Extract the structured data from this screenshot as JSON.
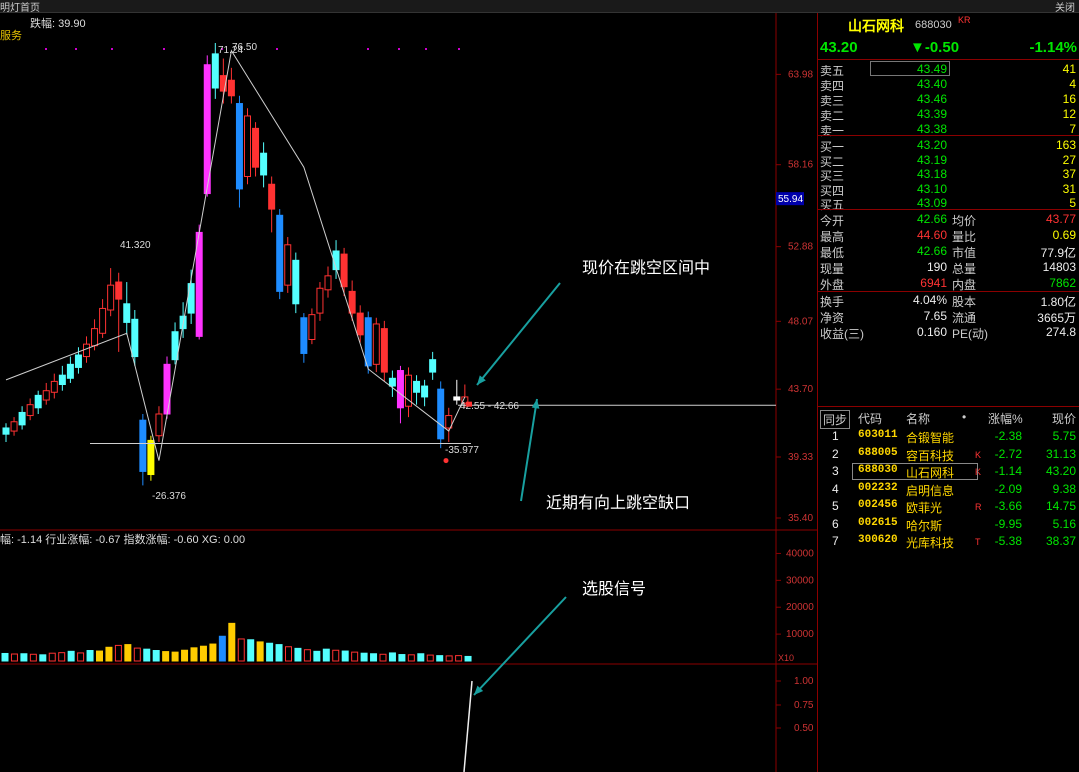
{
  "window": {
    "tab_title": "明灯首页",
    "close_label": "关闭"
  },
  "chart_header": {
    "change_range": "跌幅: 39.90",
    "service_label": "服务"
  },
  "chart_data": [
    {
      "type": "candlestick",
      "title": "",
      "y_ticks": [
        "63.98",
        "58.16",
        "52.88",
        "48.07",
        "43.70",
        "39.33",
        "35.40"
      ],
      "current_price_tag": "55.94",
      "price_annotations": [
        "41.320",
        "71.24",
        "76.50",
        "-26.376",
        "42.55 - 42.66",
        "-35.977"
      ],
      "ylim": [
        35.4,
        66.0
      ],
      "candles": [
        {
          "o": 40.8,
          "c": 41.2,
          "h": 41.5,
          "l": 40.3,
          "color": "cyan"
        },
        {
          "o": 41.0,
          "c": 41.6,
          "h": 41.9,
          "l": 40.7,
          "color": "red"
        },
        {
          "o": 41.4,
          "c": 42.2,
          "h": 42.6,
          "l": 41.1,
          "color": "cyan"
        },
        {
          "o": 42.0,
          "c": 42.7,
          "h": 43.1,
          "l": 41.7,
          "color": "red"
        },
        {
          "o": 42.5,
          "c": 43.3,
          "h": 43.6,
          "l": 42.1,
          "color": "cyan"
        },
        {
          "o": 43.0,
          "c": 43.6,
          "h": 44.1,
          "l": 42.7,
          "color": "red"
        },
        {
          "o": 43.5,
          "c": 44.2,
          "h": 44.7,
          "l": 43.1,
          "color": "red"
        },
        {
          "o": 44.0,
          "c": 44.6,
          "h": 45.2,
          "l": 43.6,
          "color": "cyan"
        },
        {
          "o": 44.4,
          "c": 45.3,
          "h": 45.8,
          "l": 44.1,
          "color": "cyan"
        },
        {
          "o": 45.1,
          "c": 45.9,
          "h": 46.4,
          "l": 44.7,
          "color": "cyan"
        },
        {
          "o": 45.8,
          "c": 46.6,
          "h": 47.1,
          "l": 45.4,
          "color": "red"
        },
        {
          "o": 46.5,
          "c": 47.6,
          "h": 48.2,
          "l": 46.2,
          "color": "red"
        },
        {
          "o": 47.3,
          "c": 48.9,
          "h": 49.5,
          "l": 47.0,
          "color": "red"
        },
        {
          "o": 48.8,
          "c": 50.4,
          "h": 51.5,
          "l": 48.4,
          "color": "red"
        },
        {
          "o": 50.6,
          "c": 49.5,
          "h": 51.2,
          "l": 46.1,
          "color": "red"
        },
        {
          "o": 49.2,
          "c": 48.0,
          "h": 50.6,
          "l": 47.2,
          "color": "cyan"
        },
        {
          "o": 48.2,
          "c": 45.8,
          "h": 48.8,
          "l": 45.2,
          "color": "cyan"
        },
        {
          "o": 41.7,
          "c": 38.4,
          "h": 42.1,
          "l": 37.5,
          "color": "blue"
        },
        {
          "o": 38.2,
          "c": 40.4,
          "h": 40.7,
          "l": 37.8,
          "color": "yellow"
        },
        {
          "o": 40.7,
          "c": 42.1,
          "h": 42.6,
          "l": 40.3,
          "color": "red"
        },
        {
          "o": 42.1,
          "c": 45.3,
          "h": 45.8,
          "l": 41.8,
          "color": "magenta"
        },
        {
          "o": 45.6,
          "c": 47.4,
          "h": 48.0,
          "l": 45.3,
          "color": "cyan"
        },
        {
          "o": 47.6,
          "c": 48.4,
          "h": 49.3,
          "l": 47.0,
          "color": "cyan"
        },
        {
          "o": 48.6,
          "c": 50.5,
          "h": 51.4,
          "l": 47.9,
          "color": "cyan"
        },
        {
          "o": 47.1,
          "c": 53.8,
          "h": 54.3,
          "l": 46.9,
          "color": "magenta"
        },
        {
          "o": 56.3,
          "c": 64.6,
          "h": 65.2,
          "l": 56.1,
          "color": "magenta"
        },
        {
          "o": 63.1,
          "c": 65.3,
          "h": 66.0,
          "l": 62.4,
          "color": "cyan"
        },
        {
          "o": 63.9,
          "c": 62.9,
          "h": 65.0,
          "l": 62.1,
          "color": "red"
        },
        {
          "o": 63.6,
          "c": 62.6,
          "h": 64.4,
          "l": 62.1,
          "color": "red"
        },
        {
          "o": 62.1,
          "c": 56.6,
          "h": 62.6,
          "l": 55.4,
          "color": "blue"
        },
        {
          "o": 57.4,
          "c": 61.3,
          "h": 61.8,
          "l": 56.9,
          "color": "red"
        },
        {
          "o": 60.5,
          "c": 58.0,
          "h": 60.9,
          "l": 57.4,
          "color": "red"
        },
        {
          "o": 58.9,
          "c": 57.5,
          "h": 59.6,
          "l": 56.7,
          "color": "cyan"
        },
        {
          "o": 56.9,
          "c": 55.3,
          "h": 57.4,
          "l": 53.8,
          "color": "red"
        },
        {
          "o": 54.9,
          "c": 50.0,
          "h": 55.3,
          "l": 49.5,
          "color": "blue"
        },
        {
          "o": 50.4,
          "c": 53.0,
          "h": 53.5,
          "l": 49.9,
          "color": "red"
        },
        {
          "o": 52.0,
          "c": 49.2,
          "h": 52.5,
          "l": 48.6,
          "color": "cyan"
        },
        {
          "o": 48.3,
          "c": 46.0,
          "h": 48.6,
          "l": 45.4,
          "color": "blue"
        },
        {
          "o": 46.9,
          "c": 48.5,
          "h": 48.9,
          "l": 46.6,
          "color": "red"
        },
        {
          "o": 48.6,
          "c": 50.2,
          "h": 50.6,
          "l": 48.1,
          "color": "red"
        },
        {
          "o": 50.1,
          "c": 51.0,
          "h": 51.6,
          "l": 49.6,
          "color": "red"
        },
        {
          "o": 51.4,
          "c": 52.6,
          "h": 53.3,
          "l": 50.8,
          "color": "cyan"
        },
        {
          "o": 52.4,
          "c": 50.3,
          "h": 52.8,
          "l": 49.7,
          "color": "red"
        },
        {
          "o": 50.0,
          "c": 48.6,
          "h": 50.7,
          "l": 48.1,
          "color": "red"
        },
        {
          "o": 48.6,
          "c": 47.2,
          "h": 49.1,
          "l": 46.7,
          "color": "red"
        },
        {
          "o": 48.3,
          "c": 45.2,
          "h": 48.7,
          "l": 44.7,
          "color": "blue"
        },
        {
          "o": 45.3,
          "c": 47.9,
          "h": 48.3,
          "l": 44.8,
          "color": "red"
        },
        {
          "o": 47.6,
          "c": 44.8,
          "h": 48.1,
          "l": 44.2,
          "color": "red"
        },
        {
          "o": 44.4,
          "c": 43.9,
          "h": 44.9,
          "l": 43.2,
          "color": "cyan"
        },
        {
          "o": 44.9,
          "c": 42.5,
          "h": 45.2,
          "l": 41.5,
          "color": "magenta"
        },
        {
          "o": 42.6,
          "c": 44.6,
          "h": 45.1,
          "l": 41.9,
          "color": "red"
        },
        {
          "o": 44.2,
          "c": 43.5,
          "h": 44.6,
          "l": 42.7,
          "color": "cyan"
        },
        {
          "o": 43.2,
          "c": 43.9,
          "h": 44.3,
          "l": 42.6,
          "color": "cyan"
        },
        {
          "o": 44.8,
          "c": 45.6,
          "h": 46.1,
          "l": 44.3,
          "color": "cyan"
        },
        {
          "o": 43.7,
          "c": 40.5,
          "h": 44.2,
          "l": 39.9,
          "color": "blue"
        },
        {
          "o": 41.2,
          "c": 42.0,
          "h": 42.5,
          "l": 40.3,
          "color": "red"
        },
        {
          "o": 43.2,
          "c": 43.0,
          "h": 44.3,
          "l": 42.7,
          "color": "white"
        },
        {
          "o": 42.8,
          "c": 43.2,
          "h": 44.0,
          "l": 42.5,
          "color": "red"
        }
      ],
      "zigzag": [
        44.3,
        47.3,
        39.1,
        65.5,
        58.0,
        45.0,
        41.0,
        43.2
      ],
      "gap_line_price": 42.66,
      "support_line_price": 40.2
    },
    {
      "type": "bar",
      "title": "",
      "y_ticks": [
        "40000",
        "30000",
        "20000",
        "10000"
      ],
      "unit_tag": "X10",
      "ylim": [
        0,
        45000
      ],
      "values": [
        2800,
        2600,
        2700,
        2500,
        2300,
        2900,
        3100,
        3600,
        3000,
        3900,
        3700,
        5100,
        5800,
        6100,
        4800,
        4400,
        3900,
        3500,
        3300,
        4000,
        4900,
        5500,
        6300,
        9200,
        14000,
        8200,
        7900,
        7100,
        6600,
        6100,
        5300,
        4700,
        4200,
        3600,
        4400,
        4000,
        3700,
        3300,
        2900,
        2700,
        2500,
        3000,
        2400,
        2300,
        2700,
        2200,
        2000,
        1900,
        2000,
        1700
      ],
      "colors": [
        "cyan",
        "red",
        "cyan",
        "red",
        "cyan",
        "red",
        "red",
        "cyan",
        "red",
        "cyan",
        "yellow",
        "yellow",
        "red",
        "yellow",
        "red",
        "cyan",
        "cyan",
        "yellow",
        "yellow",
        "yellow",
        "yellow",
        "yellow",
        "yellow",
        "blue",
        "yellow",
        "red",
        "cyan",
        "yellow",
        "cyan",
        "cyan",
        "red",
        "cyan",
        "red",
        "cyan",
        "cyan",
        "red",
        "cyan",
        "red",
        "cyan",
        "cyan",
        "red",
        "cyan",
        "cyan",
        "red",
        "cyan",
        "red",
        "cyan",
        "red",
        "red",
        "cyan"
      ]
    },
    {
      "type": "line",
      "title": "",
      "y_ticks": [
        "1.00",
        "0.75",
        "0.50"
      ],
      "ylim": [
        0.0,
        1.1
      ],
      "values": [
        0.0,
        1.0
      ]
    }
  ],
  "indicator_line": "幅: -1.14  行业涨幅: -0.67  指数涨幅: -0.60  XG: 0.00",
  "annotations": {
    "a1": "现价在跳空区间中",
    "a2": "近期有向上跳空缺口",
    "a3": "选股信号"
  },
  "quote": {
    "name": "山石网科",
    "code": "688030",
    "badge": "KR",
    "price": "43.20",
    "change": "▼-0.50",
    "pct": "-1.14%",
    "asks": [
      {
        "label": "卖五",
        "price": "43.49",
        "vol": "41"
      },
      {
        "label": "卖四",
        "price": "43.40",
        "vol": "4"
      },
      {
        "label": "卖三",
        "price": "43.46",
        "vol": "16"
      },
      {
        "label": "卖二",
        "price": "43.39",
        "vol": "12"
      },
      {
        "label": "卖一",
        "price": "43.38",
        "vol": "7"
      }
    ],
    "bids": [
      {
        "label": "买一",
        "price": "43.20",
        "vol": "163"
      },
      {
        "label": "买二",
        "price": "43.19",
        "vol": "27"
      },
      {
        "label": "买三",
        "price": "43.18",
        "vol": "37"
      },
      {
        "label": "买四",
        "price": "43.10",
        "vol": "31"
      },
      {
        "label": "买五",
        "price": "43.09",
        "vol": "5"
      }
    ],
    "stats": [
      {
        "l1": "今开",
        "v1": "42.66",
        "c1": "grn",
        "l2": "均价",
        "v2": "43.77",
        "c2": "red"
      },
      {
        "l1": "最高",
        "v1": "44.60",
        "c1": "red",
        "l2": "量比",
        "v2": "0.69",
        "c2": "yel"
      },
      {
        "l1": "最低",
        "v1": "42.66",
        "c1": "grn",
        "l2": "市值",
        "v2": "77.9亿",
        "c2": "wht"
      },
      {
        "l1": "现量",
        "v1": "190",
        "c1": "wht",
        "l2": "总量",
        "v2": "14803",
        "c2": "wht"
      },
      {
        "l1": "外盘",
        "v1": "6941",
        "c1": "red",
        "l2": "内盘",
        "v2": "7862",
        "c2": "grn"
      }
    ],
    "fin": [
      {
        "l1": "换手",
        "v1": "4.04%",
        "l2": "股本",
        "v2": "1.80亿"
      },
      {
        "l1": "净资",
        "v1": "7.65",
        "l2": "流通",
        "v2": "3665万"
      },
      {
        "l1": "收益(三)",
        "v1": "0.160",
        "l2": "PE(动)",
        "v2": "274.8"
      }
    ]
  },
  "watchlist": {
    "sync": "同步",
    "headers": [
      "代码",
      "名称",
      "•",
      "涨幅%",
      "现价"
    ],
    "rows": [
      {
        "idx": "1",
        "code": "603011",
        "name": "合锻智能",
        "flag": "",
        "chg": "-2.38",
        "price": "5.75"
      },
      {
        "idx": "2",
        "code": "688005",
        "name": "容百科技",
        "flag": "K",
        "chg": "-2.72",
        "price": "31.13"
      },
      {
        "idx": "3",
        "code": "688030",
        "name": "山石网科",
        "flag": "K",
        "chg": "-1.14",
        "price": "43.20"
      },
      {
        "idx": "4",
        "code": "002232",
        "name": "启明信息",
        "flag": "",
        "chg": "-2.09",
        "price": "9.38"
      },
      {
        "idx": "5",
        "code": "002456",
        "name": "欧菲光",
        "flag": "R",
        "chg": "-3.66",
        "price": "14.75"
      },
      {
        "idx": "6",
        "code": "002615",
        "name": "哈尔斯",
        "flag": "",
        "chg": "-9.95",
        "price": "5.16"
      },
      {
        "idx": "7",
        "code": "300620",
        "name": "光库科技",
        "flag": "T",
        "chg": "-5.38",
        "price": "38.37"
      }
    ]
  }
}
